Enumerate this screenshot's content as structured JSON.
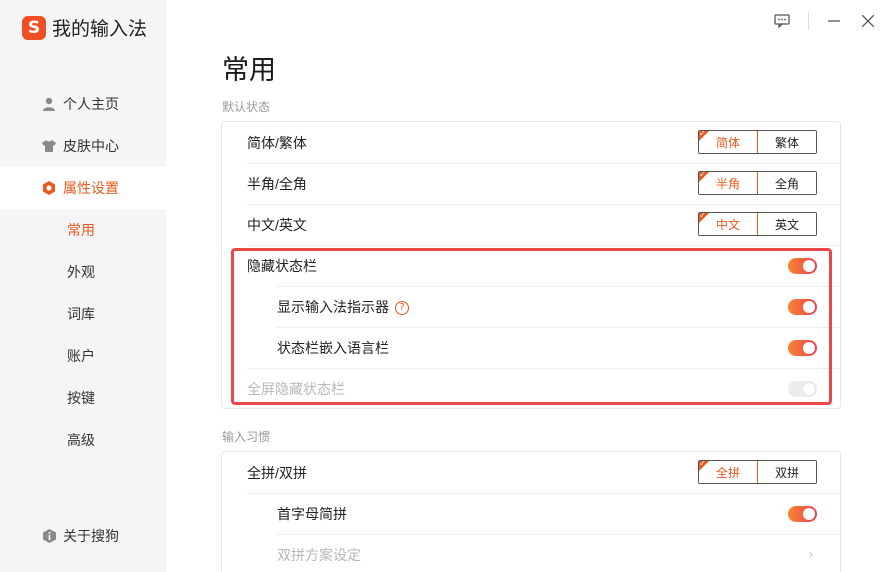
{
  "brand": {
    "logo_glyph": "S",
    "name": "我的输入法",
    "accent": "#e8591f"
  },
  "sidebar": {
    "items": [
      {
        "label": "个人主页",
        "icon": "user-icon"
      },
      {
        "label": "皮肤中心",
        "icon": "shirt-icon"
      },
      {
        "label": "属性设置",
        "icon": "settings-hexagon-icon",
        "active": true
      }
    ],
    "sub_items": [
      {
        "label": "常用",
        "active": true
      },
      {
        "label": "外观"
      },
      {
        "label": "词库"
      },
      {
        "label": "账户"
      },
      {
        "label": "按键"
      },
      {
        "label": "高级"
      }
    ],
    "about": {
      "label": "关于搜狗",
      "icon": "info-icon"
    }
  },
  "window": {
    "feedback_icon": "feedback-icon",
    "minimize_icon": "minimize-icon",
    "close_icon": "close-icon"
  },
  "main": {
    "title": "常用",
    "section1": {
      "label": "默认状态",
      "rows": [
        {
          "label": "简体/繁体",
          "options": [
            "简体",
            "繁体"
          ],
          "selected": 0
        },
        {
          "label": "半角/全角",
          "options": [
            "半角",
            "全角"
          ],
          "selected": 0
        },
        {
          "label": "中文/英文",
          "options": [
            "中文",
            "英文"
          ],
          "selected": 0
        }
      ],
      "toggles": [
        {
          "label": "隐藏状态栏",
          "on": true
        },
        {
          "label": "显示输入法指示器",
          "on": true,
          "help": "?"
        },
        {
          "label": "状态栏嵌入语言栏",
          "on": true
        },
        {
          "label": "全屏隐藏状态栏",
          "on": true,
          "disabled": true
        }
      ]
    },
    "section2": {
      "label": "输入习惯",
      "rows": [
        {
          "label": "全拼/双拼",
          "options": [
            "全拼",
            "双拼"
          ],
          "selected": 0
        }
      ],
      "toggles": [
        {
          "label": "首字母简拼",
          "on": true
        }
      ],
      "links": [
        {
          "label": "双拼方案设定",
          "disabled": true,
          "chevron": "›"
        }
      ]
    }
  }
}
